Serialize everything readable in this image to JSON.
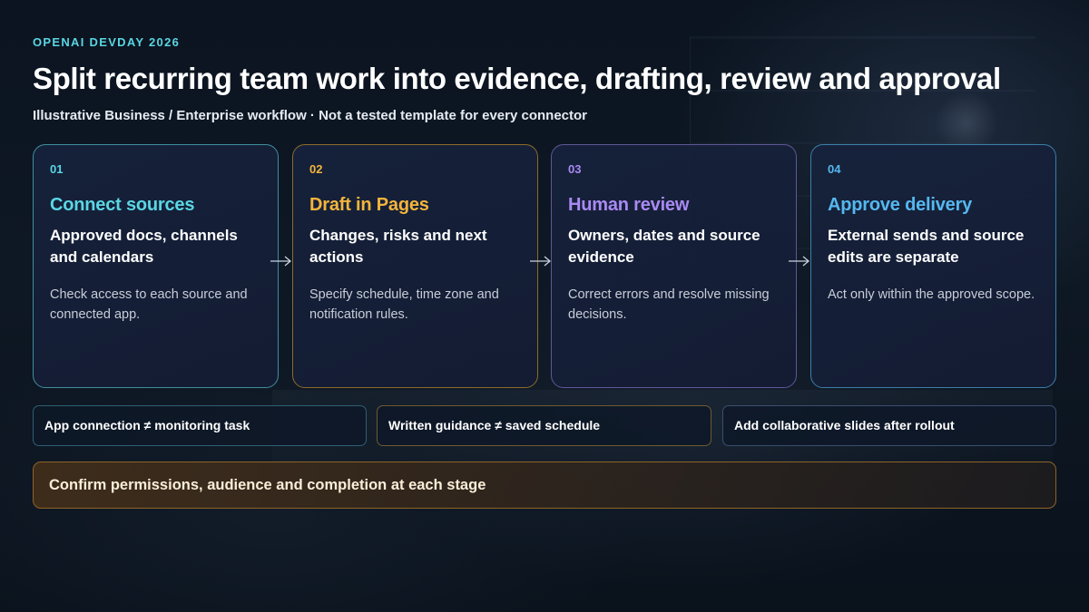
{
  "header": {
    "kicker": "OPENAI DEVDAY 2026",
    "title": "Split recurring team work into evidence, drafting, review and approval",
    "subtitle": "Illustrative Business / Enterprise workflow · Not a tested template for every connector"
  },
  "steps": [
    {
      "number": "01",
      "title": "Connect sources",
      "heading": "Approved docs, channels and calendars",
      "description": "Check access to each source and connected app.",
      "accent": "#5ad6e3",
      "border": "#3f8f9e"
    },
    {
      "number": "02",
      "title": "Draft in Pages",
      "heading": "Changes, risks and next actions",
      "description": "Specify schedule, time zone and notification rules.",
      "accent": "#f3b53c",
      "border": "#8e6a2a"
    },
    {
      "number": "03",
      "title": "Human review",
      "heading": "Owners, dates and source evidence",
      "description": "Correct errors and resolve missing decisions.",
      "accent": "#a98af3",
      "border": "#5f5796"
    },
    {
      "number": "04",
      "title": "Approve delivery",
      "heading": "External sends and source edits are separate",
      "description": "Act only within the approved scope.",
      "accent": "#55b8ef",
      "border": "#3b7fa8"
    }
  ],
  "notes": [
    {
      "text": "App connection ≠ monitoring task",
      "border": "#2f5f72"
    },
    {
      "text": "Written guidance ≠ saved schedule",
      "border": "#6e5a30"
    },
    {
      "text": "Add collaborative slides after rollout",
      "border": "#3a4e6e"
    }
  ],
  "banner": {
    "text": "Confirm permissions, audience and completion at each stage",
    "border": "#8f6426"
  },
  "icons": {
    "arrow": "right-arrow-icon"
  }
}
